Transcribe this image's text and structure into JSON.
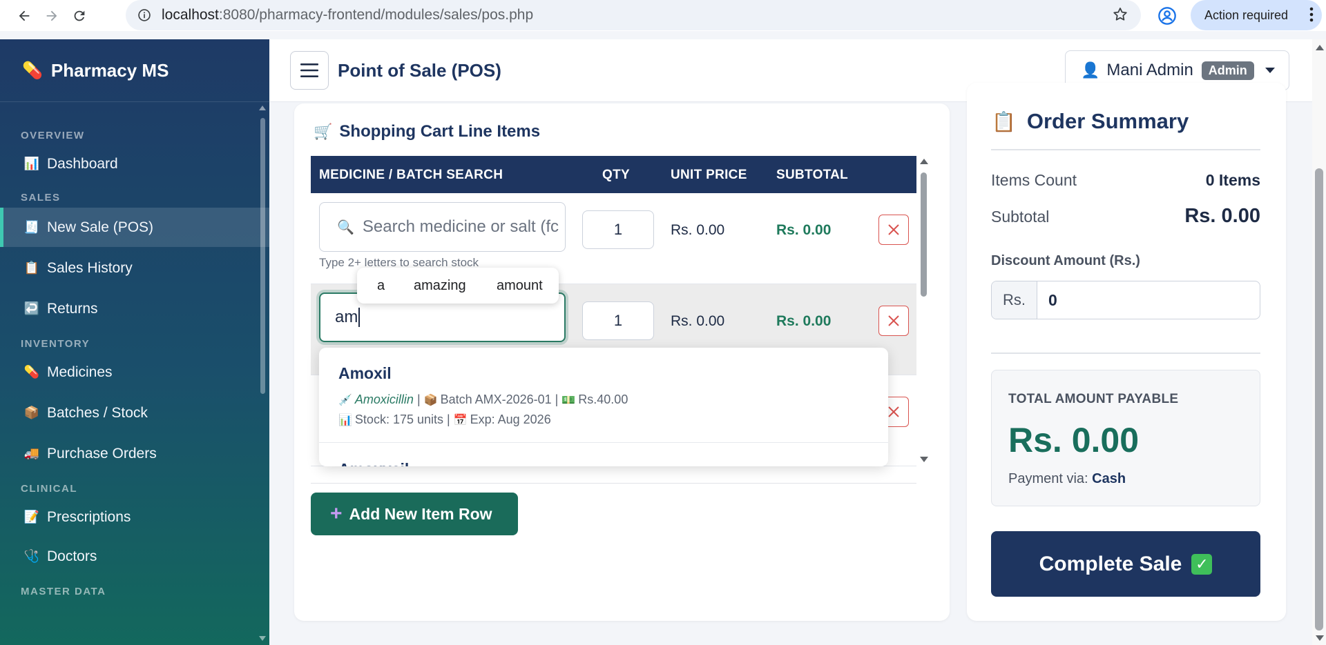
{
  "browser": {
    "url_host": "localhost",
    "url_rest": ":8080/pharmacy-frontend/modules/sales/pos.php",
    "action_label": "Action required"
  },
  "sidebar": {
    "brand": "Pharmacy MS",
    "sections": {
      "overview": "OVERVIEW",
      "sales": "SALES",
      "inventory": "INVENTORY",
      "clinical": "CLINICAL",
      "master": "MASTER DATA"
    },
    "items": {
      "dashboard": "Dashboard",
      "new_sale": "New Sale (POS)",
      "sales_history": "Sales History",
      "returns": "Returns",
      "medicines": "Medicines",
      "batches": "Batches / Stock",
      "purchase_orders": "Purchase Orders",
      "prescriptions": "Prescriptions",
      "doctors": "Doctors"
    }
  },
  "header": {
    "title": "Point of Sale (POS)",
    "user_name": "Mani Admin",
    "user_role": "Admin"
  },
  "cart": {
    "title": "Shopping Cart Line Items",
    "columns": {
      "medicine": "MEDICINE / BATCH SEARCH",
      "qty": "QTY",
      "unit_price": "UNIT PRICE",
      "subtotal": "SUBTOTAL"
    },
    "rows": [
      {
        "search_value": "",
        "search_placeholder": "Search medicine or salt (fc",
        "hint": "Type 2+ letters to search stock",
        "qty": "1",
        "unit_price": "Rs. 0.00",
        "subtotal": "Rs. 0.00"
      },
      {
        "search_value": "am",
        "qty": "1",
        "unit_price": "Rs. 0.00",
        "subtotal": "Rs. 0.00"
      }
    ],
    "add_row_label": "Add New Item Row"
  },
  "word_suggestions": [
    "a",
    "amazing",
    "amount"
  ],
  "results": [
    {
      "name": "Amoxil",
      "salt": "Amoxicillin",
      "batch": "Batch AMX-2026-01",
      "price": "Rs.40.00",
      "stock": "Stock: 175 units",
      "expiry": "Exp: Aug 2026"
    },
    {
      "name": "Amoxycil"
    }
  ],
  "summary": {
    "title": "Order Summary",
    "items_count_label": "Items Count",
    "items_count_value": "0 Items",
    "subtotal_label": "Subtotal",
    "subtotal_value": "Rs. 0.00",
    "discount_label": "Discount Amount (Rs.)",
    "discount_prefix": "Rs.",
    "discount_value": "0",
    "total_label": "TOTAL AMOUNT PAYABLE",
    "total_value": "Rs. 0.00",
    "payment_prefix": "Payment via:",
    "payment_method": "Cash",
    "complete_label": "Complete Sale"
  },
  "colors": {
    "primary_navy": "#1e3560",
    "accent_green": "#1a6b5a",
    "danger_red": "#d9534f"
  }
}
